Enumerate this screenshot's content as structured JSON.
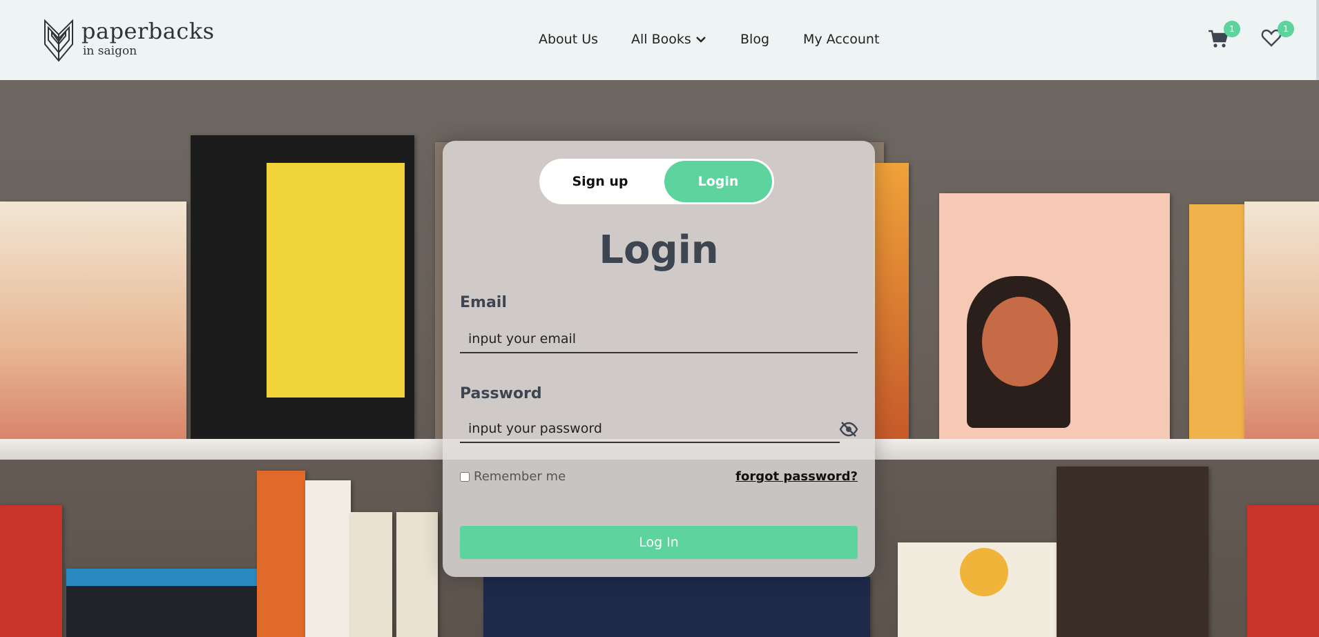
{
  "header": {
    "logo": {
      "name": "paperbacks",
      "subtitle": "in saigon",
      "icon": "book-leaves-icon"
    },
    "nav": {
      "about": "About Us",
      "books": "All Books",
      "blog": "Blog",
      "account": "My Account"
    },
    "cart": {
      "icon": "cart-icon",
      "count": "1"
    },
    "wishlist": {
      "icon": "heart-icon",
      "count": "1"
    },
    "accent_color": "#5dd39e"
  },
  "background": {
    "description_icon": "bookshelf-photo"
  },
  "login_card": {
    "toggle": {
      "signup": "Sign up",
      "login": "Login"
    },
    "title": "Login",
    "email": {
      "label": "Email",
      "placeholder": "input your email"
    },
    "password": {
      "label": "Password",
      "placeholder": "input your password",
      "icon": "eye-off-icon"
    },
    "remember": "Remember me",
    "forgot": "forgot password?",
    "submit": "Log In"
  }
}
